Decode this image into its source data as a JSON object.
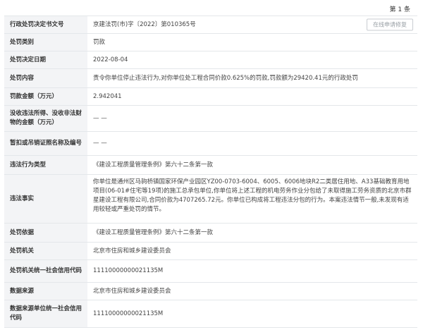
{
  "page": {
    "number_label": "第 1 条"
  },
  "repair_button": "在线申请修复",
  "rows": [
    {
      "label": "行政处罚决定书文号",
      "value": "京建法罚(市)字〔2022〕第010365号"
    },
    {
      "label": "处罚类别",
      "value": "罚款"
    },
    {
      "label": "处罚决定日期",
      "value": "2022-08-04"
    },
    {
      "label": "处罚内容",
      "value": "责令你单位停止违法行为,对你单位处工程合同价款0.625%的罚款,罚款额为29420.41元的行政处罚"
    },
    {
      "label": "罚款金额（万元）",
      "value": "2.942041"
    },
    {
      "label": "没收违法所得、没收非法财物的金额（万元）",
      "value": "— —"
    },
    {
      "label": "暂扣或吊销证照名称及编号",
      "value": "— —"
    },
    {
      "label": "违法行为类型",
      "value": "《建设工程质量管理条例》第六十二条第一款"
    },
    {
      "label": "违法事实",
      "value": "你单位是通州区马驹桥镇国家环保产业园区YZ00-0703-6004、6005、6006地块R2二类居住用地、A33基础教育用地项目(06-01#住宅等19项)的施工总承包单位,你单位将上述工程的机电劳务作业分包给了未取得施工劳务资质的北京市群星建设工程有限公司,合同价款为4707265.72元。你单位已构成将工程违法分包的行为。本案违法情节一般,未发现有适用较轻或严重处罚的情节。"
    },
    {
      "label": "处罚依据",
      "value": "《建设工程质量管理条例》第六十二条第一款"
    },
    {
      "label": "处罚机关",
      "value": "北京市住房和城乡建设委员会"
    },
    {
      "label": "处罚机关统一社会信用代码",
      "value": "11110000000021135M"
    },
    {
      "label": "数据来源",
      "value": "北京市住房和城乡建设委员会"
    },
    {
      "label": "数据来源单位统一社会信用代码",
      "value": "11110000000021135M"
    }
  ]
}
